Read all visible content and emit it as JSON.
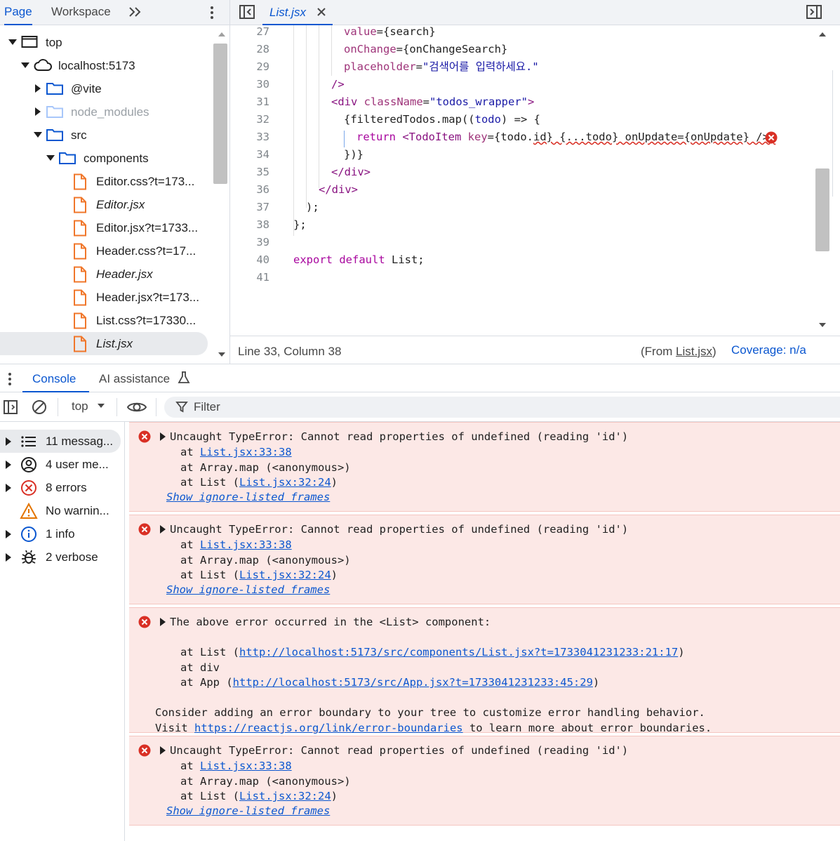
{
  "navigator": {
    "tabs": [
      "Page",
      "Workspace"
    ],
    "tree": [
      {
        "label": "top",
        "type": "frame",
        "open": true
      },
      {
        "label": "localhost:5173",
        "type": "cloud",
        "open": true
      },
      {
        "label": "@vite",
        "type": "folder",
        "open": false
      },
      {
        "label": "node_modules",
        "type": "folder",
        "open": false
      },
      {
        "label": "src",
        "type": "folder",
        "open": true
      },
      {
        "label": "components",
        "type": "folder",
        "open": true
      },
      {
        "label": "Editor.css?t=173...",
        "type": "file"
      },
      {
        "label": "Editor.jsx",
        "type": "file"
      },
      {
        "label": "Editor.jsx?t=1733...",
        "type": "file"
      },
      {
        "label": "Header.css?t=17...",
        "type": "file"
      },
      {
        "label": "Header.jsx",
        "type": "file"
      },
      {
        "label": "Header.jsx?t=173...",
        "type": "file"
      },
      {
        "label": "List.css?t=17330...",
        "type": "file"
      },
      {
        "label": "List.jsx",
        "type": "file"
      }
    ]
  },
  "editor": {
    "tab_label": "List.jsx",
    "lines": [
      {
        "n": "27",
        "parts": [
          [
            "attr",
            "value"
          ],
          [
            "pl",
            "={search}"
          ]
        ]
      },
      {
        "n": "28",
        "parts": [
          [
            "attr",
            "onChange"
          ],
          [
            "pl",
            "={onChangeSearch}"
          ]
        ]
      },
      {
        "n": "29",
        "parts": [
          [
            "attr",
            "placeholder"
          ],
          [
            "pl",
            "="
          ],
          [
            "str",
            "\"검색어를 입력하세요.\""
          ]
        ]
      },
      {
        "n": "30",
        "parts": [
          [
            "tag",
            "/>"
          ]
        ]
      },
      {
        "n": "31",
        "parts": [
          [
            "tag",
            "<div "
          ],
          [
            "attr",
            "className"
          ],
          [
            "pl",
            "="
          ],
          [
            "str",
            "\"todos_wrapper\""
          ],
          [
            "tag",
            ">"
          ]
        ]
      },
      {
        "n": "32",
        "parts": [
          [
            "pl",
            "{filteredTodos.map(("
          ],
          [
            "str",
            "todo"
          ],
          [
            "pl",
            ") => {"
          ]
        ]
      },
      {
        "n": "33",
        "parts": [
          [
            "kw",
            "return "
          ],
          [
            "tag",
            "<TodoItem "
          ],
          [
            "attr",
            "key"
          ],
          [
            "pl",
            "={todo."
          ],
          [
            "sq",
            "id} {...todo} onUpdate={onUpdate} />;"
          ]
        ]
      },
      {
        "n": "34",
        "parts": [
          [
            "pl",
            "})}"
          ]
        ]
      },
      {
        "n": "35",
        "parts": [
          [
            "tag",
            "</div>"
          ]
        ]
      },
      {
        "n": "36",
        "parts": [
          [
            "tag",
            "</div>"
          ]
        ]
      },
      {
        "n": "37",
        "parts": [
          [
            "pl",
            ");"
          ]
        ]
      },
      {
        "n": "38",
        "parts": [
          [
            "pl",
            "};"
          ]
        ]
      },
      {
        "n": "39",
        "parts": []
      },
      {
        "n": "40",
        "parts": [
          [
            "kw",
            "export default "
          ],
          [
            "pl",
            "List;"
          ]
        ]
      },
      {
        "n": "41",
        "parts": []
      }
    ],
    "status": {
      "position": "Line 33, Column 38",
      "from_prefix": "(From ",
      "from_link": "List.jsx",
      "from_suffix": ")",
      "coverage": "Coverage: n/a"
    }
  },
  "console": {
    "tabs": [
      "Console",
      "AI assistance"
    ],
    "context": "top",
    "filter_placeholder": "Filter",
    "sidebar": [
      {
        "label": "11 messag...",
        "icon": "list-icon"
      },
      {
        "label": "4 user me...",
        "icon": "user-icon"
      },
      {
        "label": "8 errors",
        "icon": "error-icon"
      },
      {
        "label": "No warnin...",
        "icon": "warning-icon"
      },
      {
        "label": "1 info",
        "icon": "info-icon"
      },
      {
        "label": "2 verbose",
        "icon": "bug-icon"
      }
    ],
    "messages": [
      {
        "title": "Uncaught TypeError: Cannot read properties of undefined (reading 'id')",
        "frames": [
          {
            "pre": "at ",
            "link": "List.jsx:33:38",
            "post": ""
          },
          {
            "pre": "at Array.map (<anonymous>)",
            "link": "",
            "post": ""
          },
          {
            "pre": "at List (",
            "link": "List.jsx:32:24",
            "post": ")"
          }
        ],
        "show": "Show ignore-listed frames"
      },
      {
        "title": "Uncaught TypeError: Cannot read properties of undefined (reading 'id')",
        "frames": [
          {
            "pre": "at ",
            "link": "List.jsx:33:38",
            "post": ""
          },
          {
            "pre": "at Array.map (<anonymous>)",
            "link": "",
            "post": ""
          },
          {
            "pre": "at List (",
            "link": "List.jsx:32:24",
            "post": ")"
          }
        ],
        "show": "Show ignore-listed frames"
      },
      {
        "title": "The above error occurred in the <List> component:",
        "frames": [
          {
            "pre": "at List (",
            "link": "http://localhost:5173/src/components/List.jsx?t=1733041231233:21:17",
            "post": ")"
          },
          {
            "pre": "at div",
            "link": "",
            "post": ""
          },
          {
            "pre": "at App (",
            "link": "http://localhost:5173/src/App.jsx?t=1733041231233:45:29",
            "post": ")"
          }
        ],
        "note1": "Consider adding an error boundary to your tree to customize error handling behavior.",
        "note2_pre": "Visit ",
        "note2_link": "https://reactjs.org/link/error-boundaries",
        "note2_post": " to learn more about error boundaries."
      },
      {
        "title": "Uncaught TypeError: Cannot read properties of undefined (reading 'id')",
        "frames": [
          {
            "pre": "at ",
            "link": "List.jsx:33:38",
            "post": ""
          },
          {
            "pre": "at Array.map (<anonymous>)",
            "link": "",
            "post": ""
          },
          {
            "pre": "at List (",
            "link": "List.jsx:32:24",
            "post": ")"
          }
        ],
        "show": "Show ignore-listed frames"
      }
    ]
  }
}
